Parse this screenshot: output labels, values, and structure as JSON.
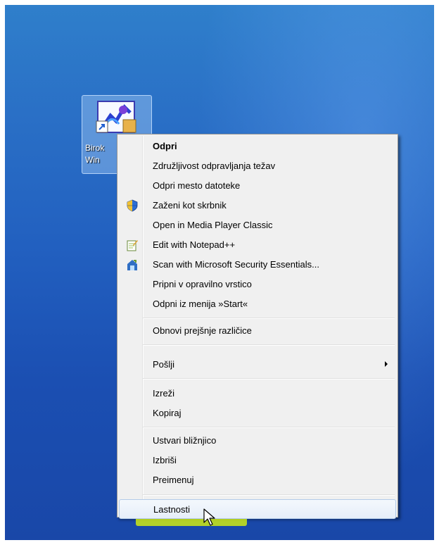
{
  "desktop_icon": {
    "label": "Birok\nWin",
    "icon_name": "application-shortcut-icon"
  },
  "context_menu": {
    "items": [
      {
        "label": "Odpri",
        "bold": true,
        "icon": null
      },
      {
        "label": "Združljivost odpravljanja težav",
        "icon": null
      },
      {
        "label": "Odpri mesto datoteke",
        "icon": null
      },
      {
        "label": "Zaženi kot skrbnik",
        "icon": "uac-shield-icon"
      },
      {
        "label": "Open in Media Player Classic",
        "icon": null
      },
      {
        "label": "Edit with Notepad++",
        "icon": "notepad-plus-plus-icon"
      },
      {
        "label": "Scan with Microsoft Security Essentials...",
        "icon": "security-essentials-icon"
      },
      {
        "label": "Pripni v opravilno vrstico",
        "icon": null
      },
      {
        "label": "Odpni iz menija »Start«",
        "icon": null
      },
      {
        "label": "Obnovi prejšnje različice",
        "icon": null
      },
      {
        "label": "Pošlji",
        "icon": null,
        "submenu": true
      },
      {
        "label": "Izreži",
        "icon": null
      },
      {
        "label": "Kopiraj",
        "icon": null
      },
      {
        "label": "Ustvari bližnjico",
        "icon": null
      },
      {
        "label": "Izbriši",
        "icon": null
      },
      {
        "label": "Preimenuj",
        "icon": null
      },
      {
        "label": "Lastnosti",
        "icon": null,
        "hovered": true
      }
    ]
  },
  "colors": {
    "desktop_top": "#2f7fcb",
    "desktop_bottom": "#1947a8",
    "menu_background": "#f0f0f0",
    "highlight": "#e6ff00"
  }
}
